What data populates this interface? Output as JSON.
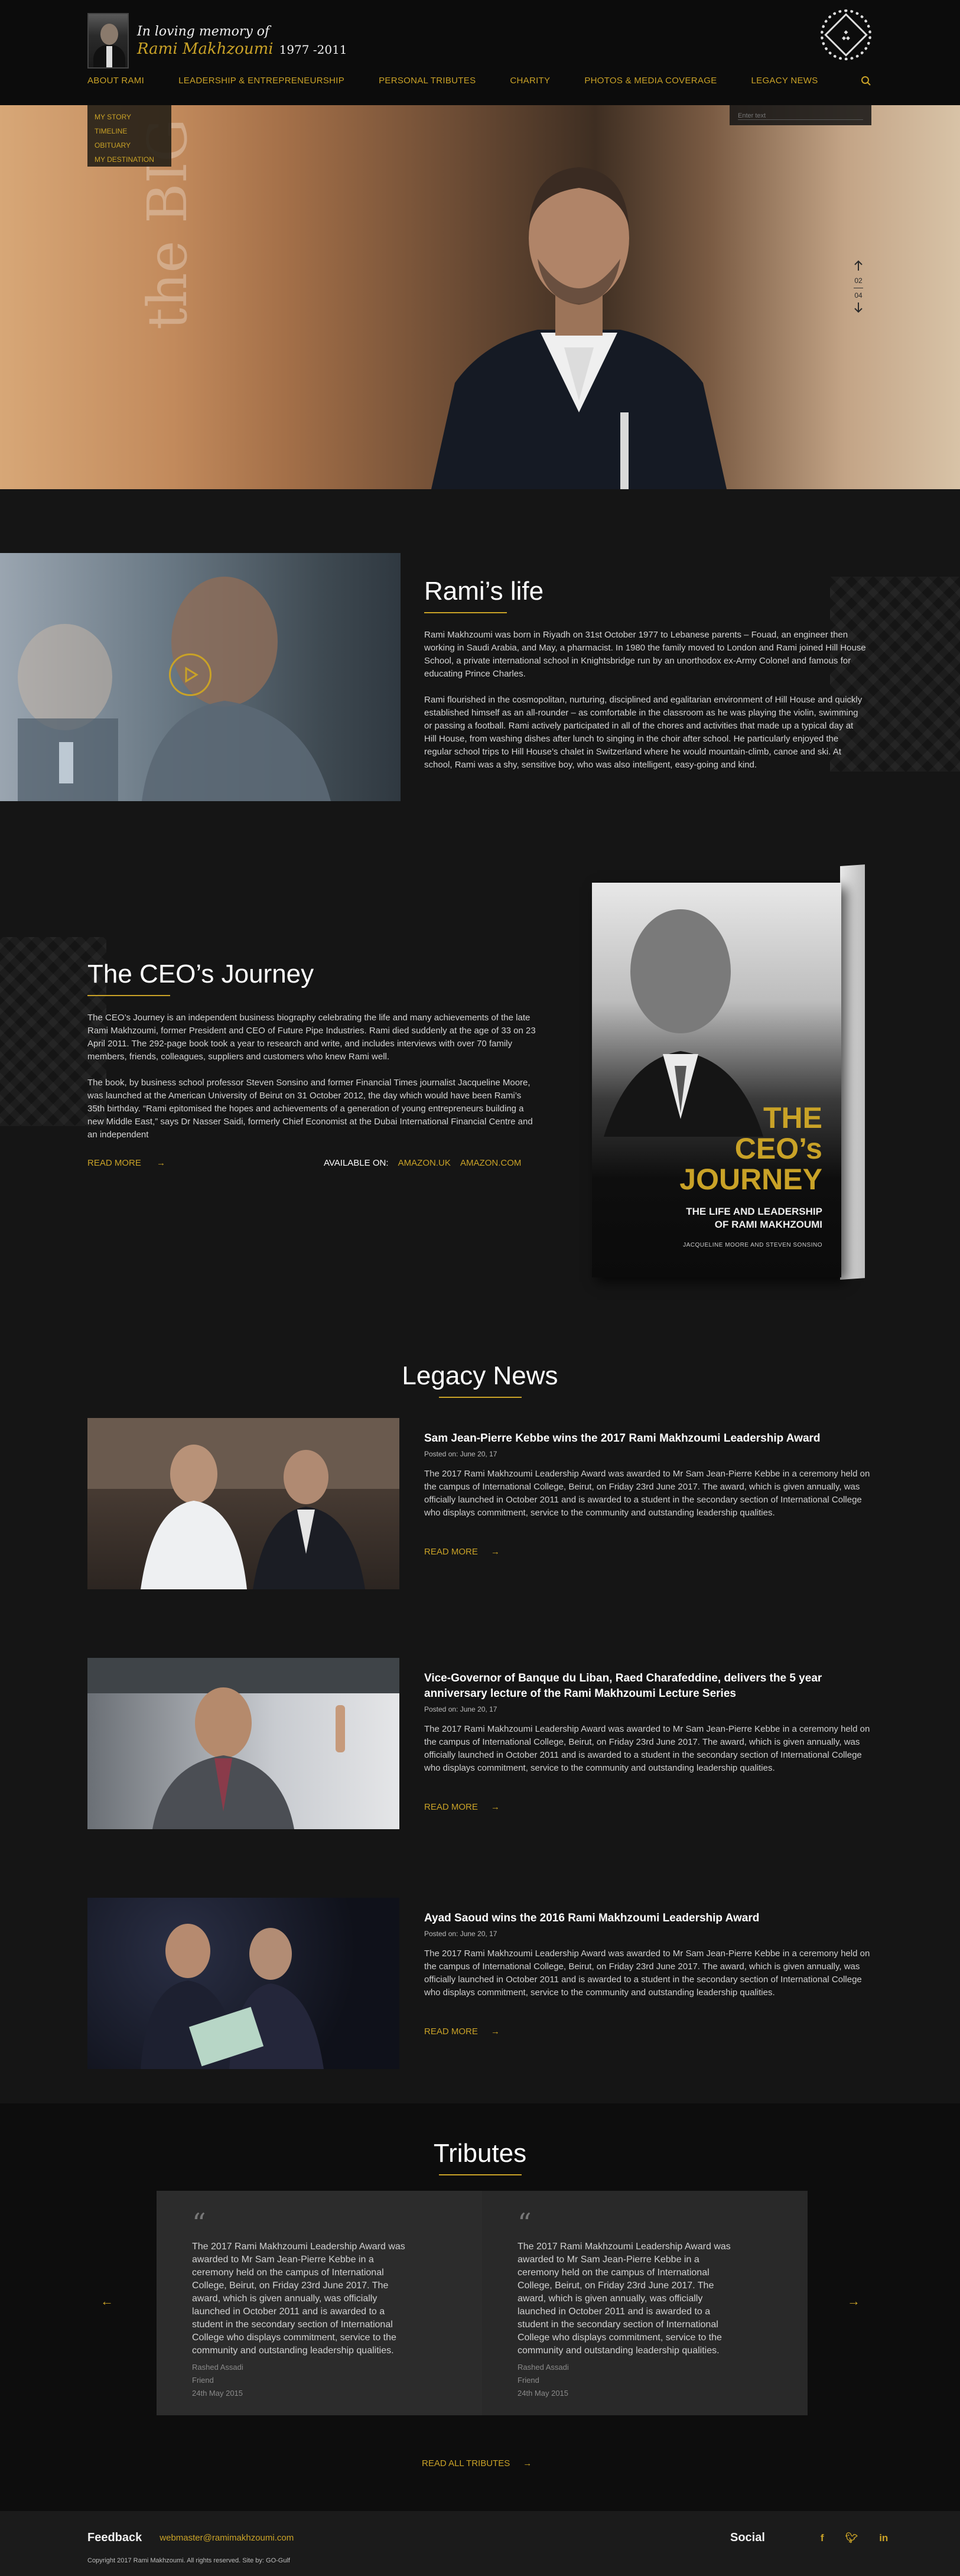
{
  "header": {
    "memory_line": "In loving memory of",
    "name": "Rami Makhzoumi",
    "years": "1977 -2011",
    "nav": [
      "ABOUT RAMI",
      "LEADERSHIP & ENTREPRENEURSHIP",
      "PERSONAL TRIBUTES",
      "CHARITY",
      "PHOTOS & MEDIA COVERAGE",
      "LEGACY NEWS"
    ],
    "dropdown": [
      "MY STORY",
      "TIMELINE",
      "OBITUARY",
      "MY DESTINATION"
    ]
  },
  "hero": {
    "text": "the BIG pictu",
    "search_placeholder": "Enter text",
    "slide_current": "02",
    "slide_total": "04"
  },
  "life": {
    "title": "Rami’s life",
    "p1": "Rami Makhzoumi was born in Riyadh on 31st October 1977 to Lebanese parents – Fouad, an engineer then working in Saudi Arabia, and May, a pharmacist. In 1980 the family moved to London and Rami joined Hill House School, a private international school in Knightsbridge run by an unorthodox ex-Army Colonel and famous for educating Prince Charles.",
    "p2": "Rami flourished in the cosmopolitan, nurturing, disciplined and egalitarian environment of Hill House and quickly established himself as an all-rounder – as comfortable in the classroom as he was playing the violin, swimming or passing a football. Rami actively participated in all of the chores and activities that made up a typical day at Hill House, from washing dishes after lunch to singing in the choir after school. He particularly enjoyed the regular school trips to Hill House’s chalet in Switzerland where he would mountain-climb, canoe and ski. At school, Rami was a shy, sensitive boy, who was also intelligent, easy-going and kind."
  },
  "ceo": {
    "title": "The CEO’s Journey",
    "p1": "The CEO’s Journey is an independent business biography celebrating the life and many achievements of the late Rami Makhzoumi, former President and CEO of Future Pipe Industries. Rami died suddenly at the age of 33 on 23 April 2011. The 292-page book took a year to research and write, and includes interviews with over 70 family members, friends, colleagues, suppliers and customers who knew Rami well.",
    "p2": "The book, by business school professor Steven Sonsino and former Financial Times journalist Jacqueline Moore, was launched at the American University of Beirut on 31 October 2012, the day which would have been Rami’s 35th birthday. “Rami epitomised the hopes and achievements of a generation of young entrepreneurs building a new Middle East,” says Dr Nasser Saidi, formerly Chief Economist at the Dubai International Financial Centre and an independent",
    "read_more": "READ MORE",
    "available_on": "AVAILABLE ON:",
    "amazon_uk": "AMAZON.UK",
    "amazon_com": "AMAZON.COM",
    "book_title_1": "THE",
    "book_title_2": "CEO’s",
    "book_title_3": "JOURNEY",
    "book_sub_1": "THE LIFE AND LEADERSHIP",
    "book_sub_2": "OF RAMI MAKHZOUMI",
    "book_authors": "JACQUELINE MOORE AND STEVEN SONSINO"
  },
  "news": {
    "title": "Legacy News",
    "items": [
      {
        "title": "Sam Jean-Pierre Kebbe wins the 2017 Rami Makhzoumi Leadership Award",
        "date": "Posted on: June 20, 17",
        "text": "The 2017 Rami Makhzoumi Leadership Award was awarded to Mr Sam Jean-Pierre Kebbe in a ceremony held on the campus of International College, Beirut, on Friday 23rd June 2017. The award, which is given annually, was officially launched in October 2011 and is awarded to a student in the secondary section of International College who displays commitment, service to the community and outstanding leadership qualities.",
        "read_more": "READ MORE"
      },
      {
        "title": "Vice-Governor of Banque du Liban, Raed Charafeddine, delivers the 5 year anniversary lecture of the Rami Makhzoumi Lecture Series",
        "date": "Posted on: June 20, 17",
        "text": "The 2017 Rami Makhzoumi Leadership Award was awarded to Mr Sam Jean-Pierre Kebbe in a ceremony held on the campus of International College, Beirut, on Friday 23rd June 2017. The award, which is given annually, was officially launched in October 2011 and is awarded to a student in the secondary section of International College who displays commitment, service to the community and outstanding leadership qualities.",
        "read_more": "READ MORE"
      },
      {
        "title": "Ayad Saoud wins the 2016 Rami Makhzoumi Leadership Award",
        "date": "Posted on: June 20, 17",
        "text": "The 2017 Rami Makhzoumi Leadership Award was awarded to Mr Sam Jean-Pierre Kebbe in a ceremony held on the campus of International College, Beirut, on Friday 23rd June 2017. The award, which is given annually, was officially launched in October 2011 and is awarded to a student in the secondary section of International College who displays commitment, service to the community and outstanding leadership qualities.",
        "read_more": "READ MORE"
      }
    ]
  },
  "tributes": {
    "title": "Tributes",
    "cards": [
      {
        "text": "The 2017 Rami Makhzoumi Leadership Award was awarded to Mr Sam Jean-Pierre Kebbe in a ceremony held on the campus of International College, Beirut, on Friday 23rd June 2017. The award, which is given annually, was officially launched in October 2011 and is awarded to a student in the secondary section of International College who displays commitment, service to the community and outstanding leadership qualities.",
        "author": "Rashed Assadi",
        "relation": "Friend",
        "date": "24th May 2015"
      },
      {
        "text": "The 2017 Rami Makhzoumi Leadership Award was awarded to Mr Sam Jean-Pierre Kebbe in a ceremony held on the campus of International College, Beirut, on Friday 23rd June 2017. The award, which is given annually, was officially launched in October 2011 and is awarded to a student in the secondary section of International College who displays commitment, service to the community and outstanding leadership qualities.",
        "author": "Rashed Assadi",
        "relation": "Friend",
        "date": "24th May 2015"
      }
    ],
    "read_all": "READ ALL TRIBUTES"
  },
  "footer": {
    "feedback_label": "Feedback",
    "email": "webmaster@ramimakhzoumi.com",
    "social_label": "Social",
    "copyright": "Copyright 2017 Rami Makhzoumi. All rights reserved. Site by: GO-Gulf"
  },
  "colors": {
    "accent": "#c9a227",
    "background": "#151515"
  }
}
